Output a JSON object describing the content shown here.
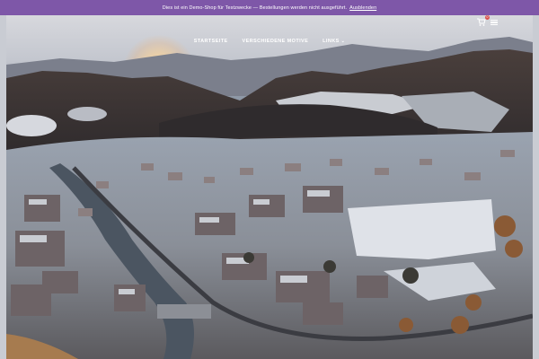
{
  "notice": {
    "text": "Dies ist ein Demo-Shop für Testzwecke — Bestellungen werden nicht ausgeführt.",
    "dismiss_label": "Ausblenden"
  },
  "nav": {
    "items": [
      {
        "label": "STARTSEITE"
      },
      {
        "label": "VERSCHIEDENE MOTIVE"
      },
      {
        "label": "LINKS",
        "has_dropdown": true
      }
    ]
  },
  "header": {
    "cart_icon": "cart-icon",
    "cart_count": "0",
    "menu_icon": "hamburger-menu-icon"
  },
  "hero": {
    "image": "aerial winter town valley at sunrise"
  },
  "colors": {
    "notice_bg": "#7e57a8",
    "nav_text": "#ffffff"
  }
}
